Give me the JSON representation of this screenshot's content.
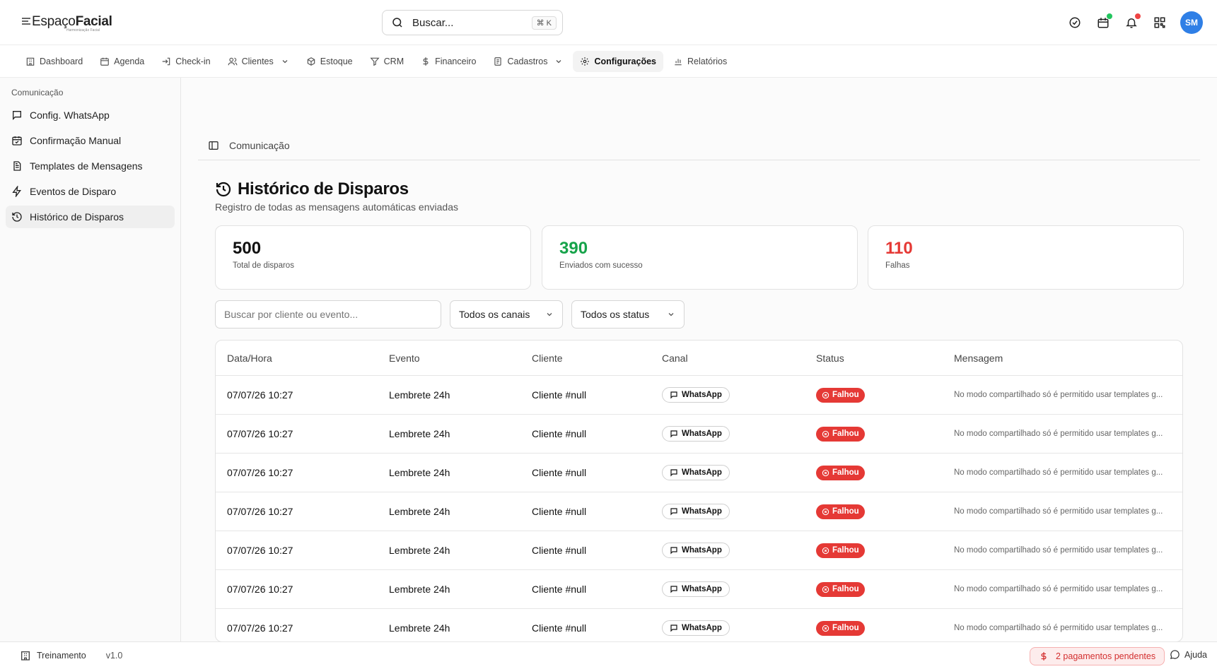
{
  "brand": {
    "name_light": "Espaço",
    "name_bold": "Facial",
    "tagline": "Harmonização Facial"
  },
  "search": {
    "placeholder": "Buscar...",
    "shortcut": "⌘ K"
  },
  "header_icons": [
    {
      "name": "check-circle-icon"
    },
    {
      "name": "calendar-icon",
      "dot_color": "#22c55e"
    },
    {
      "name": "bell-icon",
      "dot_color": "#ef4444"
    },
    {
      "name": "qr-code-icon"
    }
  ],
  "user": {
    "initials": "SM",
    "avatar_color": "#2f7fe6"
  },
  "nav": [
    {
      "label": "Dashboard",
      "icon": "building-icon"
    },
    {
      "label": "Agenda",
      "icon": "calendar-icon"
    },
    {
      "label": "Check-in",
      "icon": "login-icon"
    },
    {
      "label": "Clientes",
      "icon": "users-icon",
      "dropdown": true
    },
    {
      "label": "Estoque",
      "icon": "package-icon"
    },
    {
      "label": "CRM",
      "icon": "filter-icon"
    },
    {
      "label": "Financeiro",
      "icon": "dollar-icon"
    },
    {
      "label": "Cadastros",
      "icon": "clipboard-icon",
      "dropdown": true
    },
    {
      "label": "Configurações",
      "icon": "gear-icon",
      "active": true
    },
    {
      "label": "Relatórios",
      "icon": "bar-chart-icon"
    }
  ],
  "sidebar": {
    "group": "Comunicação",
    "items": [
      {
        "label": "Config. WhatsApp",
        "icon": "message-icon"
      },
      {
        "label": "Confirmação Manual",
        "icon": "calendar-check-icon"
      },
      {
        "label": "Templates de Mensagens",
        "icon": "file-text-icon"
      },
      {
        "label": "Eventos de Disparo",
        "icon": "zap-icon"
      },
      {
        "label": "Histórico de Disparos",
        "icon": "history-icon",
        "active": true
      }
    ]
  },
  "breadcrumb": "Comunicação",
  "page": {
    "title": "Histórico de Disparos",
    "subtitle": "Registro de todas as mensagens automáticas enviadas"
  },
  "stats": [
    {
      "value": "500",
      "label": "Total de disparos",
      "color": "#111111"
    },
    {
      "value": "390",
      "label": "Enviados com sucesso",
      "color": "#16a34a"
    },
    {
      "value": "110",
      "label": "Falhas",
      "color": "#e53935"
    }
  ],
  "filters": {
    "search_placeholder": "Buscar por cliente ou evento...",
    "channel": "Todos os canais",
    "status": "Todos os status"
  },
  "table": {
    "columns": [
      "Data/Hora",
      "Evento",
      "Cliente",
      "Canal",
      "Status",
      "Mensagem"
    ],
    "rows": [
      {
        "datetime": "07/07/26 10:27",
        "event": "Lembrete 24h",
        "client": "Cliente #null",
        "channel": "WhatsApp",
        "status": "Falhou",
        "message": "No modo compartilhado só é permitido usar templates g..."
      },
      {
        "datetime": "07/07/26 10:27",
        "event": "Lembrete 24h",
        "client": "Cliente #null",
        "channel": "WhatsApp",
        "status": "Falhou",
        "message": "No modo compartilhado só é permitido usar templates g..."
      },
      {
        "datetime": "07/07/26 10:27",
        "event": "Lembrete 24h",
        "client": "Cliente #null",
        "channel": "WhatsApp",
        "status": "Falhou",
        "message": "No modo compartilhado só é permitido usar templates g..."
      },
      {
        "datetime": "07/07/26 10:27",
        "event": "Lembrete 24h",
        "client": "Cliente #null",
        "channel": "WhatsApp",
        "status": "Falhou",
        "message": "No modo compartilhado só é permitido usar templates g..."
      },
      {
        "datetime": "07/07/26 10:27",
        "event": "Lembrete 24h",
        "client": "Cliente #null",
        "channel": "WhatsApp",
        "status": "Falhou",
        "message": "No modo compartilhado só é permitido usar templates g..."
      },
      {
        "datetime": "07/07/26 10:27",
        "event": "Lembrete 24h",
        "client": "Cliente #null",
        "channel": "WhatsApp",
        "status": "Falhou",
        "message": "No modo compartilhado só é permitido usar templates g..."
      },
      {
        "datetime": "07/07/26 10:27",
        "event": "Lembrete 24h",
        "client": "Cliente #null",
        "channel": "WhatsApp",
        "status": "Falhou",
        "message": "No modo compartilhado só é permitido usar templates g..."
      }
    ]
  },
  "footer": {
    "env": "Treinamento",
    "version": "v1.0",
    "pending": "2 pagamentos pendentes",
    "help": "Ajuda"
  }
}
